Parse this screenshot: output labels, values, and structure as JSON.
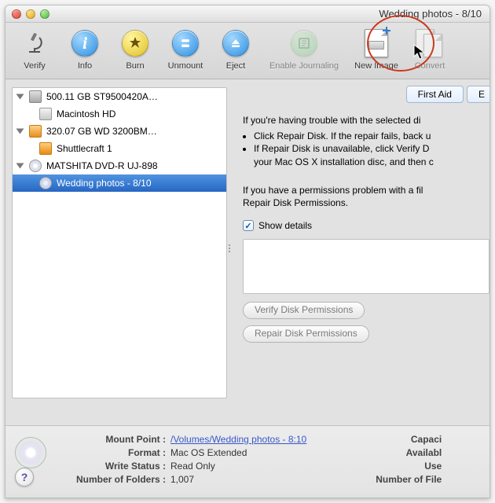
{
  "window": {
    "title": "Wedding photos - 8/10"
  },
  "toolbar": {
    "verify": {
      "label": "Verify"
    },
    "info": {
      "label": "Info"
    },
    "burn": {
      "label": "Burn"
    },
    "unmount": {
      "label": "Unmount"
    },
    "eject": {
      "label": "Eject"
    },
    "enable": {
      "label": "Enable Journaling"
    },
    "newimage": {
      "label": "New Image"
    },
    "convert": {
      "label": "Convert"
    }
  },
  "sidebar": {
    "items": [
      {
        "label": "500.11 GB ST9500420A…"
      },
      {
        "label": "Macintosh HD"
      },
      {
        "label": "320.07 GB WD 3200BM…"
      },
      {
        "label": "Shuttlecraft 1"
      },
      {
        "label": "MATSHITA DVD-R UJ-898"
      },
      {
        "label": "Wedding photos - 8/10"
      }
    ]
  },
  "tabs": {
    "first_aid": "First Aid",
    "next": "E"
  },
  "panel": {
    "intro": "If you're having trouble with the selected di",
    "b1": "Click Repair Disk. If the repair fails, back u",
    "b2a": "If Repair Disk is unavailable, click Verify D",
    "b2b": "your Mac OS X installation disc, and then c",
    "perm1": "If you have a permissions problem with a fil",
    "perm2": "Repair Disk Permissions.",
    "show_details": "Show details",
    "verify_perm": "Verify Disk Permissions",
    "repair_perm": "Repair Disk Permissions"
  },
  "status": {
    "mount_point_k": "Mount Point :",
    "mount_point_v": "/Volumes/Wedding photos - 8:10",
    "format_k": "Format :",
    "format_v": "Mac OS Extended",
    "write_k": "Write Status :",
    "write_v": "Read Only",
    "folders_k": "Number of Folders :",
    "folders_v": "1,007",
    "capacity_k": "Capaci",
    "available_k": "Availabl",
    "used_k": "Use",
    "files_k": "Number of File"
  }
}
